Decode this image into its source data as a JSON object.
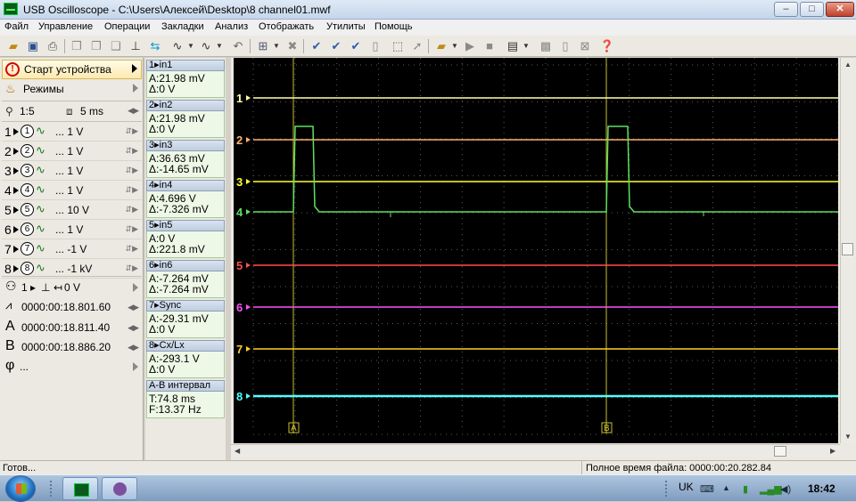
{
  "window": {
    "title": "USB Oscilloscope - C:\\Users\\Алексей\\Desktop\\8 channel01.mwf",
    "min_label": "‒",
    "max_label": "□",
    "close_label": "✕"
  },
  "menu": [
    "Файл",
    "Управление",
    "Операции",
    "Закладки",
    "Анализ",
    "Отображать",
    "Утилиты",
    "Помощь"
  ],
  "left_panel": {
    "start_label": "Старт устройства",
    "modes_label": "Режимы",
    "zoom_value": "1:5",
    "timebase_value": "5 ms",
    "channels": [
      {
        "num": "1",
        "circle": "1",
        "volt": "... 1 V"
      },
      {
        "num": "2",
        "circle": "2",
        "volt": "... 1 V"
      },
      {
        "num": "3",
        "circle": "3",
        "volt": "... 1 V"
      },
      {
        "num": "4",
        "circle": "4",
        "volt": "... 1 V"
      },
      {
        "num": "5",
        "circle": "5",
        "volt": "... 10 V"
      },
      {
        "num": "6",
        "circle": "6",
        "volt": "... 1 V"
      },
      {
        "num": "7",
        "circle": "7",
        "volt": "... -1 V"
      },
      {
        "num": "8",
        "circle": "8",
        "volt": "... -1 kV"
      }
    ],
    "trigger": {
      "channel": "1",
      "level": "0 V"
    },
    "time_cursor": "0000:00:18.801.60",
    "cursor_a_label": "A",
    "cursor_a": "0000:00:18.811.40",
    "cursor_b_label": "B",
    "cursor_b": "0000:00:18.886.20",
    "phi_label": "φ",
    "phi_value": "..."
  },
  "measurements": [
    {
      "head": "1▸in1",
      "a": "A:21.98 mV",
      "d": "Δ:0 V"
    },
    {
      "head": "2▸in2",
      "a": "A:21.98 mV",
      "d": "Δ:0 V"
    },
    {
      "head": "3▸in3",
      "a": "A:36.63 mV",
      "d": "Δ:-14.65 mV"
    },
    {
      "head": "4▸in4",
      "a": "A:4.696 V",
      "d": "Δ:-7.326 mV"
    },
    {
      "head": "5▸in5",
      "a": "A:0 V",
      "d": "Δ:221.8 mV"
    },
    {
      "head": "6▸in6",
      "a": "A:-7.264 mV",
      "d": "Δ:-7.264 mV"
    },
    {
      "head": "7▸Sync",
      "a": "A:-29.31 mV",
      "d": "Δ:0 V"
    },
    {
      "head": "8▸Cx/Lx",
      "a": "A:-293.1 V",
      "d": "Δ:0 V"
    },
    {
      "head": "A-B интервал",
      "a": "T:74.8 ms",
      "d": "F:13.37 Hz"
    }
  ],
  "scope": {
    "channels": [
      {
        "label": "1",
        "color": "#ffffa8"
      },
      {
        "label": "2",
        "color": "#ffb070"
      },
      {
        "label": "3",
        "color": "#ffff30"
      },
      {
        "label": "4",
        "color": "#60e060"
      },
      {
        "label": "5",
        "color": "#ff5050"
      },
      {
        "label": "6",
        "color": "#ff50ff"
      },
      {
        "label": "7",
        "color": "#ffd020"
      },
      {
        "label": "8",
        "color": "#50ffff"
      }
    ],
    "cursor_a_marker": "A",
    "cursor_b_marker": "B",
    "cursor_color": "#c8c030"
  },
  "status": {
    "left": "Готов...",
    "right": "Полное время файла: 0000:00:20.282.84"
  },
  "taskbar": {
    "lang": "UK",
    "clock": "18:42"
  }
}
